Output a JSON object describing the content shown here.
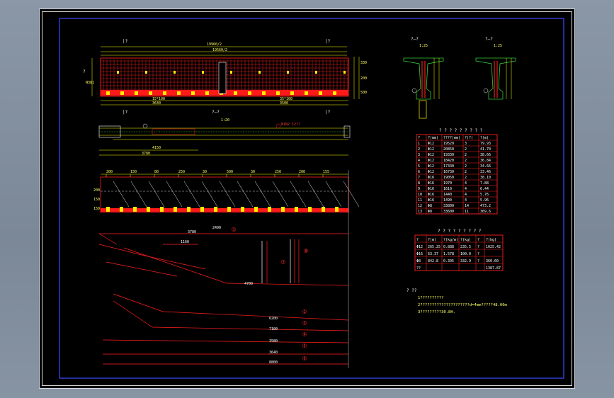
{
  "sheet": {
    "border_color": "#dfe4ea",
    "frame_color": "#3b4cff",
    "line_colors": {
      "red": "#ff2020",
      "yellow": "#ffff00",
      "green": "#33cc33",
      "white": "#ffffff"
    }
  },
  "elevation": {
    "section_marks": [
      "|?",
      "|?",
      "|?",
      "|?"
    ],
    "span_half_label": "19960/2",
    "span_half_label_2": "19560/2",
    "side_mark": "?",
    "bottom_dims": [
      "15*100",
      "35*100"
    ],
    "bottom_dims_2": [
      "3640",
      "3500"
    ],
    "left_note": "N3Q1",
    "end_dims": [
      "330",
      "200",
      "500"
    ]
  },
  "plan": {
    "section_label": "?—?",
    "section_scale": "1:20",
    "dims": [
      "4150",
      "3780"
    ],
    "note": "N1N2 12??"
  },
  "strand_layout": {
    "top_dims": [
      "200",
      "150",
      "80",
      "250",
      "30",
      "500",
      "30",
      "250",
      "200",
      "155"
    ],
    "side_dims": [
      "200",
      "150",
      "150"
    ]
  },
  "bar_details": {
    "dims": [
      "3780",
      "2490",
      "1160",
      "4700",
      "6200",
      "7100",
      "3580",
      "3640",
      "8800"
    ],
    "marks": [
      "1",
      "2",
      "3",
      "4",
      "5",
      "6",
      "7",
      "8"
    ]
  },
  "section_views": [
    {
      "label": "?—?",
      "scale": "1:25"
    },
    {
      "label": "?—?",
      "scale": "1:25"
    }
  ],
  "rebar_table": {
    "title": "? ? ? ? ? ? ? ? ?",
    "headers": [
      "?",
      "?(mm)",
      "????(mm)",
      "?(?)",
      "?(m)"
    ],
    "rows": [
      [
        "1",
        "Φ12",
        "19520",
        "3",
        "79.93"
      ],
      [
        "2",
        "Φ12",
        "20850",
        "2",
        "41.70"
      ],
      [
        "3",
        "Φ12",
        "19330",
        "2",
        "38.66"
      ],
      [
        "4",
        "Φ12",
        "18420",
        "2",
        "36.84"
      ],
      [
        "5",
        "Φ12",
        "17330",
        "2",
        "34.66"
      ],
      [
        "6",
        "Φ12",
        "16730",
        "2",
        "33.46"
      ],
      [
        "7",
        "Φ16",
        "19050",
        "2",
        "38.10"
      ],
      [
        "8",
        "Φ16",
        "1970",
        "4",
        "7.88"
      ],
      [
        "9",
        "Φ16",
        "1610",
        "4",
        "6.44"
      ],
      [
        "10",
        "Φ16",
        "1440",
        "4",
        "5.76"
      ],
      [
        "11",
        "Φ16",
        "1490",
        "4",
        "5.96"
      ],
      [
        "12",
        "Φ8",
        "33800",
        "14",
        "473.2"
      ],
      [
        "13",
        "Φ8",
        "33600",
        "11",
        "369.6"
      ]
    ]
  },
  "summary_table": {
    "title": "? ? ? ? ? ? ? ? ?",
    "headers": [
      "?",
      "?(m)",
      "?(kg/m)",
      "?(kg)",
      "?",
      "?(kg)"
    ],
    "rows": [
      [
        "Φ12",
        "265.25",
        "0.888",
        "235.5",
        "?",
        "1025.42"
      ],
      [
        "Φ16",
        "63.37",
        "1.578",
        "100.0",
        "?",
        ""
      ],
      [
        "Φ8",
        "842.8",
        "0.395",
        "332.9",
        "?",
        "360.60"
      ],
      [
        "??",
        "",
        "",
        "",
        "",
        "1387.87"
      ]
    ]
  },
  "notes": {
    "title": "? ??",
    "lines": [
      "1??????????",
      "2?????????????????????d=4mm?????48.00m",
      "3?????????30.8H."
    ]
  }
}
